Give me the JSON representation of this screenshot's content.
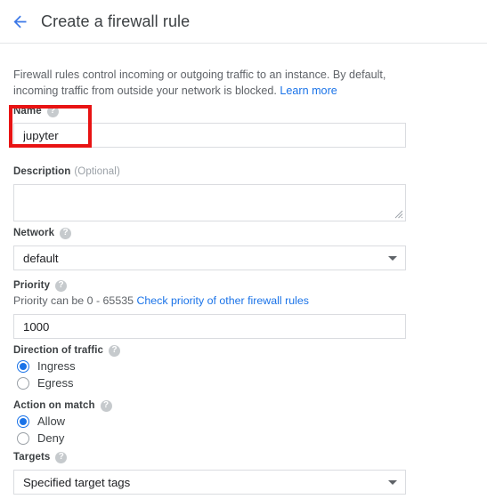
{
  "header": {
    "back_icon": "arrow-left-icon",
    "title": "Create a firewall rule"
  },
  "intro": {
    "text": "Firewall rules control incoming or outgoing traffic to an instance. By default, incoming traffic from outside your network is blocked. ",
    "link_label": "Learn more"
  },
  "fields": {
    "name": {
      "label": "Name",
      "help_icon": "help-circle-icon",
      "value": "jupyter",
      "placeholder": ""
    },
    "description": {
      "label": "Description",
      "optional": "(Optional)",
      "value": "",
      "placeholder": ""
    },
    "network": {
      "label": "Network",
      "help_icon": "help-circle-icon",
      "value": "default",
      "options": [
        "default"
      ]
    },
    "priority": {
      "label": "Priority",
      "help_icon": "help-circle-icon",
      "hint": "Priority can be 0 - 65535 ",
      "hint_link": "Check priority of other firewall rules",
      "value": "1000",
      "placeholder": ""
    },
    "direction": {
      "label": "Direction of traffic",
      "help_icon": "help-circle-icon",
      "options": [
        {
          "label": "Ingress",
          "checked": true
        },
        {
          "label": "Egress",
          "checked": false
        }
      ]
    },
    "action": {
      "label": "Action on match",
      "help_icon": "help-circle-icon",
      "options": [
        {
          "label": "Allow",
          "checked": true
        },
        {
          "label": "Deny",
          "checked": false
        }
      ]
    },
    "targets": {
      "label": "Targets",
      "help_icon": "help-circle-icon",
      "value": "Specified target tags",
      "options": [
        "Specified target tags"
      ]
    }
  },
  "colors": {
    "accent": "#1a73e8",
    "highlight": "#e81313",
    "text": "#3c4043",
    "muted": "#5f6368",
    "border": "#dadce0"
  }
}
